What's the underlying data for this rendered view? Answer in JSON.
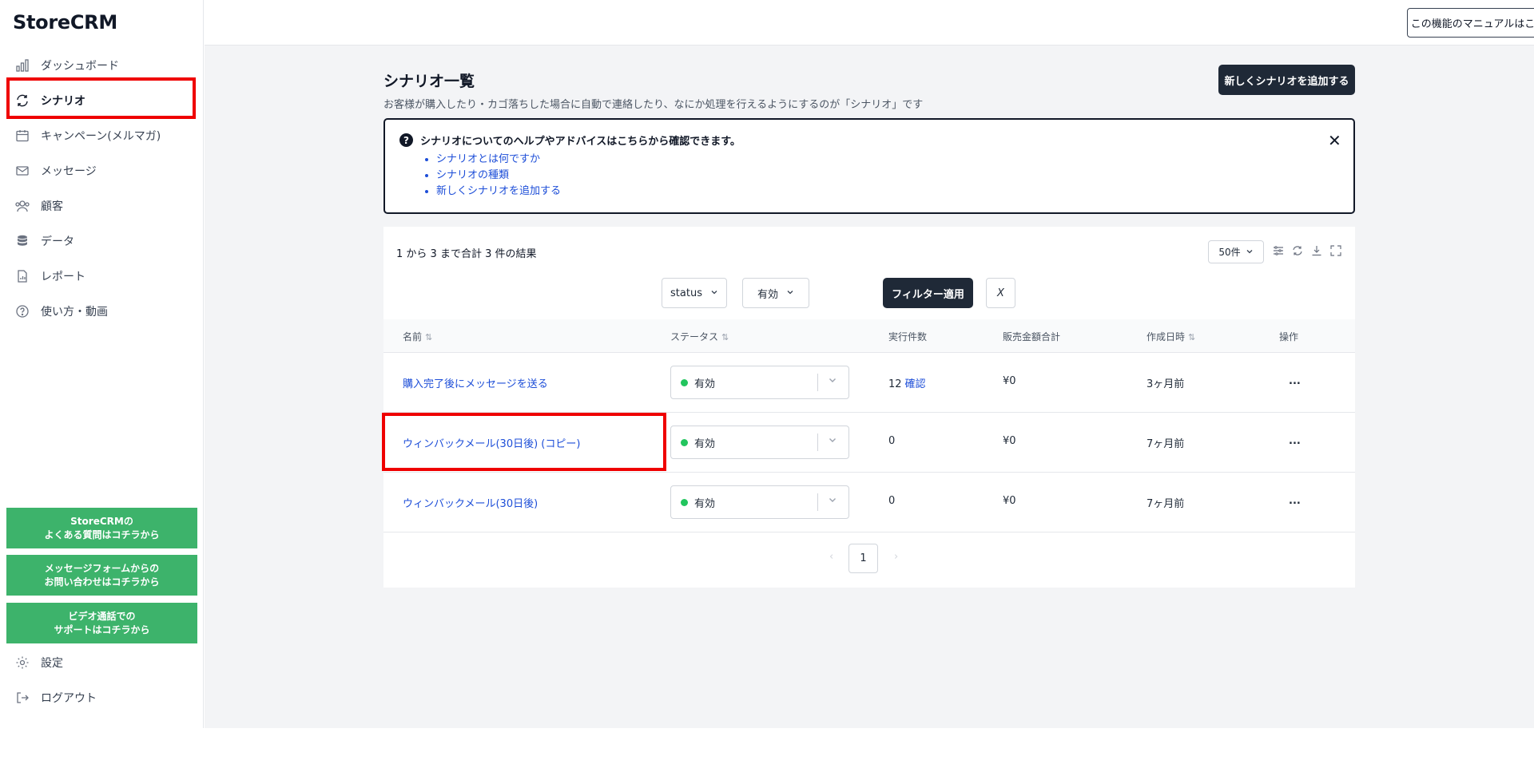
{
  "app": {
    "logo": "StoreCRM"
  },
  "sidebar": {
    "items": [
      {
        "label": "ダッシュボード",
        "icon": "bar-chart-icon"
      },
      {
        "label": "シナリオ",
        "icon": "refresh-icon",
        "active": true
      },
      {
        "label": "キャンペーン(メルマガ)",
        "icon": "calendar-icon"
      },
      {
        "label": "メッセージ",
        "icon": "mail-icon"
      },
      {
        "label": "顧客",
        "icon": "users-icon"
      },
      {
        "label": "データ",
        "icon": "database-icon"
      },
      {
        "label": "レポート",
        "icon": "report-icon"
      },
      {
        "label": "使い方・動画",
        "icon": "help-circle-icon"
      }
    ],
    "support_buttons": [
      {
        "label": "StoreCRMの\nよくある質問はコチラから"
      },
      {
        "label": "メッセージフォームからの\nお問い合わせはコチラから"
      },
      {
        "label": "ビデオ通話での\nサポートはコチラから"
      }
    ],
    "bottom_items": [
      {
        "label": "設定",
        "icon": "gear-icon"
      },
      {
        "label": "ログアウト",
        "icon": "logout-icon"
      }
    ]
  },
  "topbar": {
    "manual_button": "この機能のマニュアルはこちら"
  },
  "page": {
    "title": "シナリオ一覧",
    "subtitle": "お客様が購入したり・カゴ落ちした場合に自動で連絡したり、なにか処理を行えるようにするのが「シナリオ」です",
    "add_button": "新しくシナリオを追加する"
  },
  "help": {
    "title": "シナリオについてのヘルプやアドバイスはこちらから確認できます。",
    "links": [
      "シナリオとは何ですか",
      "シナリオの種類",
      "新しくシナリオを追加する"
    ],
    "close": "✕"
  },
  "table": {
    "result_text": "1 から 3 まで合計 3 件の結果",
    "page_size": "50件",
    "filter": {
      "field": "status",
      "value": "有効",
      "apply": "フィルター適用",
      "clear": "X"
    },
    "headers": [
      "名前",
      "ステータス",
      "実行件数",
      "販売金額合計",
      "作成日時",
      "操作"
    ],
    "rows": [
      {
        "name": "購入完了後にメッセージを送る",
        "status": "有効",
        "count": "12",
        "confirm": "確認",
        "sales": "¥0",
        "created": "3ヶ月前",
        "action": "..."
      },
      {
        "name": "ウィンバックメール(30日後) (コピー)",
        "status": "有効",
        "count": "0",
        "confirm": "",
        "sales": "¥0",
        "created": "7ヶ月前",
        "action": "..."
      },
      {
        "name": "ウィンバックメール(30日後)",
        "status": "有効",
        "count": "0",
        "confirm": "",
        "sales": "¥0",
        "created": "7ヶ月前",
        "action": "..."
      }
    ],
    "pagination": {
      "prev": "‹",
      "current": "1",
      "next": "›"
    }
  },
  "colors": {
    "accent_dark": "#1f2937",
    "link": "#1d4ed8",
    "support_green": "#3db36b",
    "status_green": "#22c55e",
    "highlight": "#ef0000"
  }
}
